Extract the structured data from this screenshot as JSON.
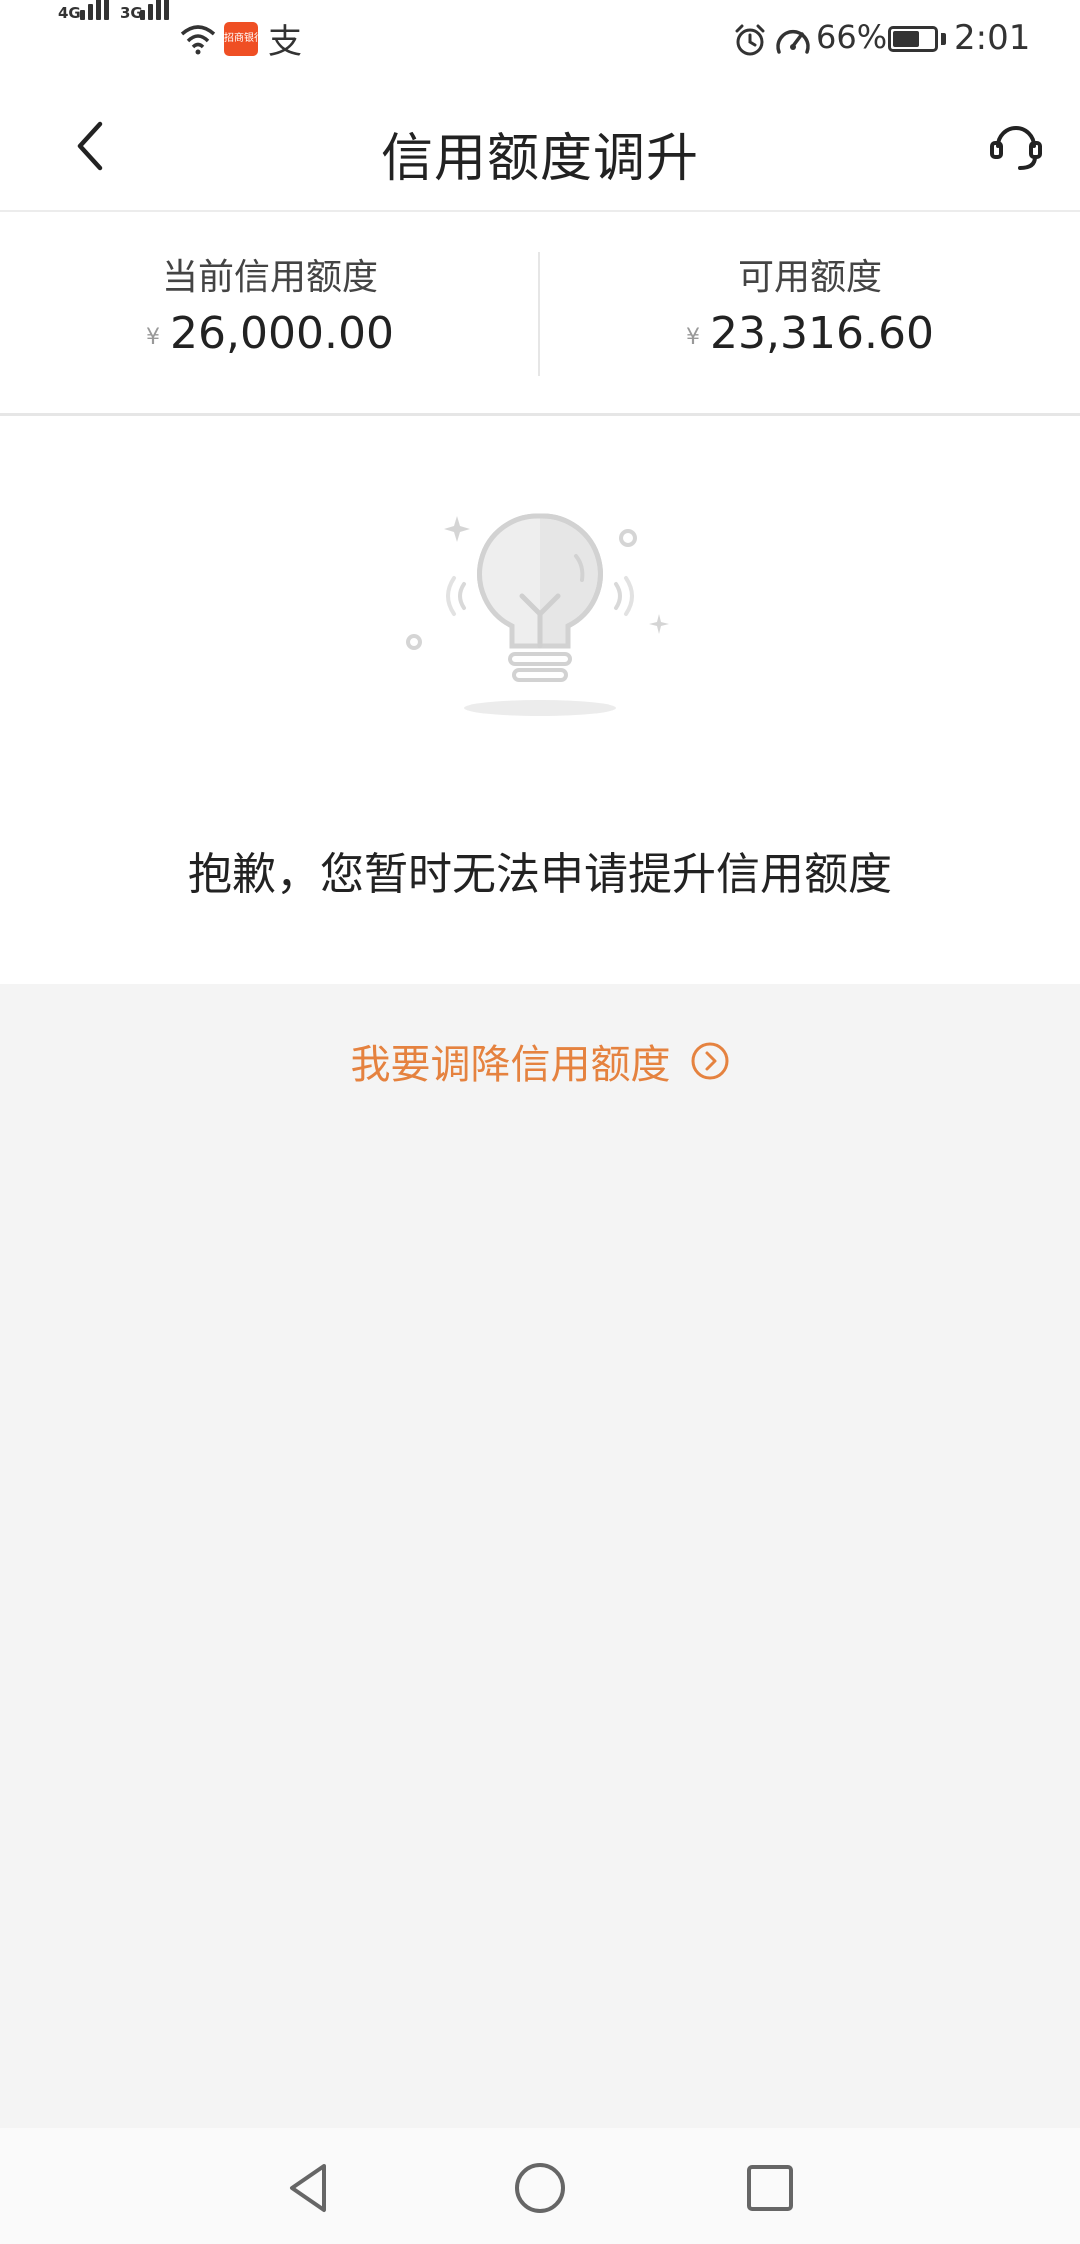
{
  "status_bar": {
    "network1": "4G",
    "network2": "3G",
    "battery_percent": "66%",
    "battery_level": 0.66,
    "time": "2:01",
    "pay_icon_glyph": "支",
    "app_badge_text": "招商银行"
  },
  "header": {
    "title": "信用额度调升",
    "back_icon": "chevron-left-icon",
    "service_icon": "headset-icon"
  },
  "summary": {
    "current_limit_label": "当前信用额度",
    "current_limit_currency": "¥",
    "current_limit_amount": "26,000.00",
    "available_label": "可用额度",
    "available_currency": "¥",
    "available_amount": "23,316.60"
  },
  "empty_state": {
    "illustration": "lightbulb-icon",
    "message": "抱歉，您暂时无法申请提升信用额度"
  },
  "decrease_link": {
    "label": "我要调降信用额度",
    "icon": "arrow-right-circle-icon",
    "color": "#e5823f"
  },
  "nav_bar": {
    "back_icon": "triangle-back-icon",
    "home_icon": "circle-home-icon",
    "recents_icon": "square-recents-icon"
  }
}
